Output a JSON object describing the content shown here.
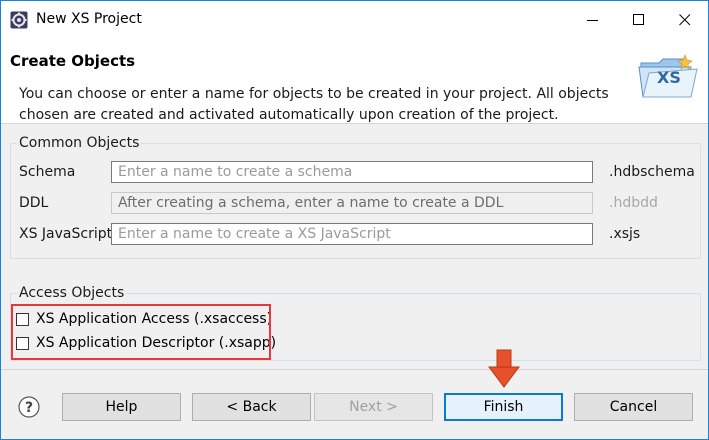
{
  "window": {
    "title": "New XS Project",
    "icon": "eclipse-gear-icon"
  },
  "header": {
    "title": "Create Objects",
    "description": "You can choose or enter a name for objects to be created in your project. All objects chosen are created and activated automatically upon creation of the project.",
    "logo_text": "XS"
  },
  "common_objects": {
    "legend": "Common Objects",
    "rows": [
      {
        "label": "Schema",
        "value": "",
        "placeholder": "Enter a name to create a schema",
        "suffix": ".hdbschema",
        "enabled": true
      },
      {
        "label": "DDL",
        "value": "",
        "placeholder": "After creating a schema, enter a name to create a DDL",
        "suffix": ".hdbdd",
        "enabled": false
      },
      {
        "label": "XS JavaScript",
        "value": "",
        "placeholder": "Enter a name to create a XS JavaScript",
        "suffix": ".xsjs",
        "enabled": true
      }
    ]
  },
  "access_objects": {
    "legend": "Access Objects",
    "items": [
      {
        "label": "XS Application Access (.xsaccess)",
        "checked": false
      },
      {
        "label": "XS Application Descriptor (.xsapp)",
        "checked": false
      }
    ]
  },
  "buttons": {
    "help": "Help",
    "back": "< Back",
    "next": "Next >",
    "finish": "Finish",
    "cancel": "Cancel"
  },
  "colors": {
    "highlight": "#e8383d",
    "arrow": "#e8502a",
    "default_button_border": "#0a78d7"
  }
}
